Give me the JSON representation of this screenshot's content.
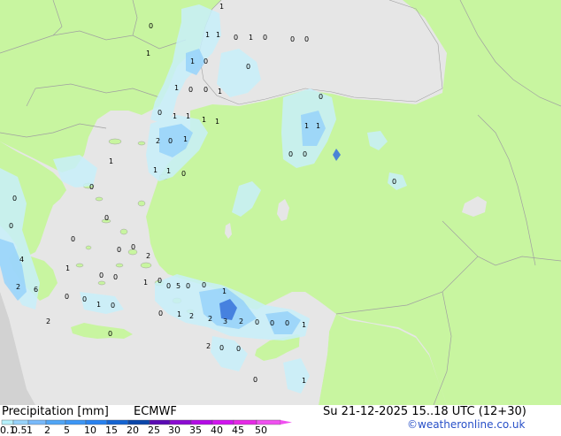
{
  "title": "Precipitation [mm]",
  "model": "ECMWF",
  "valid_time": "Su 21-12-2025 15..18 UTC (12+30)",
  "credit": "©weatheronline.co.uk",
  "legend": {
    "levels": [
      "0.1",
      "0.5",
      "1",
      "2",
      "5",
      "10",
      "15",
      "20",
      "25",
      "30",
      "35",
      "40",
      "45",
      "50"
    ],
    "colors": [
      "#b4f0fa",
      "#96d2fa",
      "#78b9fa",
      "#50a5f5",
      "#3c96f5",
      "#2882f0",
      "#1464d2",
      "#0a46aa",
      "#5a0ab4",
      "#8c0ad2",
      "#b40ae6",
      "#d214f0",
      "#e628e6",
      "#f050f0"
    ]
  },
  "colors": {
    "sea": "#e6e6e6",
    "land": "#c8f5a0",
    "outside": "#d2d2d2",
    "border": "#a0a0a0",
    "precip_light": "#c8f0fa",
    "precip_mid": "#96d2fa",
    "precip_heavy": "#3c78dc"
  },
  "map_numbers": [
    "1",
    "0",
    "1",
    "1",
    "0",
    "1",
    "0",
    "0",
    "0",
    "1",
    "0",
    "1",
    "0",
    "1",
    "0",
    "0",
    "1",
    "0",
    "0",
    "1",
    "1",
    "1",
    "1",
    "1",
    "1",
    "2",
    "0",
    "1",
    "0",
    "0",
    "1",
    "1",
    "0",
    "1",
    "0",
    "0",
    "0",
    "0",
    "0",
    "0",
    "0",
    "2",
    "0",
    "1",
    "0",
    "0",
    "1",
    "0",
    "0",
    "0",
    "0",
    "5",
    "0",
    "0",
    "1",
    "0",
    "0",
    "1",
    "2",
    "2",
    "1",
    "3",
    "2",
    "0",
    "0",
    "0",
    "1",
    "0",
    "2",
    "0",
    "0",
    "0",
    "1",
    "4",
    "2",
    "6",
    "2"
  ]
}
